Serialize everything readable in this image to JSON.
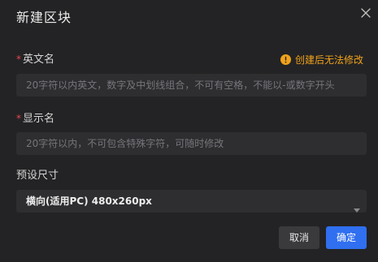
{
  "dialog": {
    "title": "新建区块",
    "close_icon": "close-icon"
  },
  "fields": {
    "english_name": {
      "required_mark": "*",
      "label": "英文名",
      "warning_icon": "warning-icon",
      "warning_text": "创建后无法修改",
      "placeholder": "20字符以内英文，数字及中划线组合，不可有空格，不能以-或数字开头",
      "value": ""
    },
    "display_name": {
      "required_mark": "*",
      "label": "显示名",
      "placeholder": "20字符以内，不可包含特殊字符，可随时修改",
      "value": ""
    },
    "preset_size": {
      "label": "预设尺寸",
      "selected": "横向(适用PC) 480x260px",
      "caret_icon": "caret-down-icon"
    }
  },
  "actions": {
    "cancel_label": "取消",
    "confirm_label": "确定"
  },
  "colors": {
    "background": "#232325",
    "input_background": "#2e2e31",
    "required": "#e5484d",
    "warning": "#f0a21a",
    "primary": "#2f6ff0"
  }
}
